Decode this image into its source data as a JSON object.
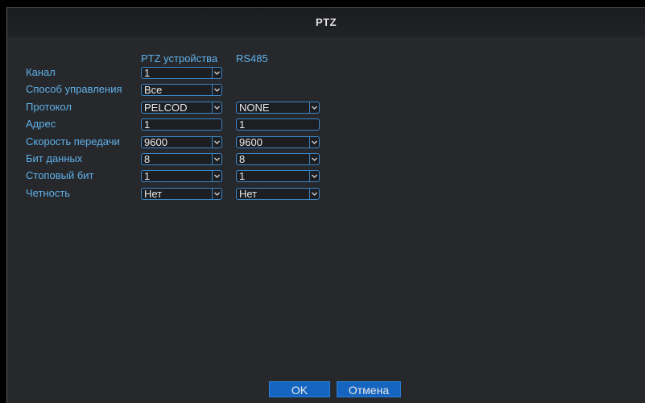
{
  "window": {
    "title": "PTZ"
  },
  "columns": {
    "ptz_label": "PTZ устройства",
    "rs485_label": "RS485"
  },
  "rows": [
    {
      "label": "Канал",
      "ptz": "1",
      "ptz_type": "select"
    },
    {
      "label": "Способ управления",
      "ptz": "Все",
      "ptz_type": "select"
    },
    {
      "label": "Протокол",
      "ptz": "PELCOD",
      "ptz_type": "select",
      "rs485": "NONE",
      "rs485_type": "select"
    },
    {
      "label": "Адрес",
      "ptz": "1",
      "ptz_type": "input",
      "rs485": "1",
      "rs485_type": "input"
    },
    {
      "label": "Скорость передачи",
      "ptz": "9600",
      "ptz_type": "select",
      "rs485": "9600",
      "rs485_type": "select"
    },
    {
      "label": "Бит данных",
      "ptz": "8",
      "ptz_type": "select",
      "rs485": "8",
      "rs485_type": "select"
    },
    {
      "label": "Стоповый бит",
      "ptz": "1",
      "ptz_type": "select",
      "rs485": "1",
      "rs485_type": "select"
    },
    {
      "label": "Четность",
      "ptz": "Нет",
      "ptz_type": "select",
      "rs485": "Нет",
      "rs485_type": "select"
    }
  ],
  "buttons": {
    "ok": "OK",
    "cancel": "Отмена"
  },
  "colors": {
    "label": "#5fb1e8",
    "field_border": "#3a86c8",
    "button_bg": "#1565c0",
    "panel_bg": "#26282c"
  },
  "icons": {
    "dropdown": "chevron-down-icon"
  }
}
